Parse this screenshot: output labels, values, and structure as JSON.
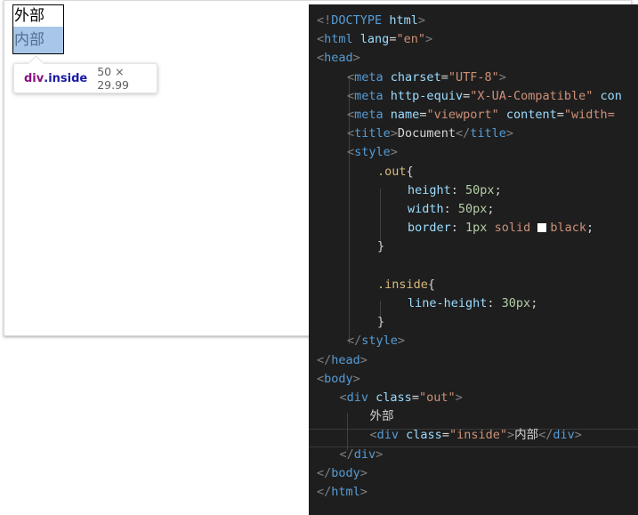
{
  "preview": {
    "out_text": "外部",
    "inside_text": "内部",
    "tooltip": {
      "tag": "div",
      "selector": ".inside",
      "dimensions": "50 × 29.99"
    }
  },
  "editor": {
    "lines": [
      {
        "indent": 0,
        "tokens": [
          {
            "c": "punct",
            "t": "<!"
          },
          {
            "c": "tag",
            "t": "DOCTYPE"
          },
          {
            "c": "text",
            "t": " "
          },
          {
            "c": "attr",
            "t": "html"
          },
          {
            "c": "punct",
            "t": ">"
          }
        ]
      },
      {
        "indent": 0,
        "tokens": [
          {
            "c": "punct",
            "t": "<"
          },
          {
            "c": "tag",
            "t": "html"
          },
          {
            "c": "text",
            "t": " "
          },
          {
            "c": "attr",
            "t": "lang"
          },
          {
            "c": "text",
            "t": "="
          },
          {
            "c": "str",
            "t": "\"en\""
          },
          {
            "c": "punct",
            "t": ">"
          }
        ]
      },
      {
        "indent": 0,
        "tokens": [
          {
            "c": "punct",
            "t": "<"
          },
          {
            "c": "tag",
            "t": "head"
          },
          {
            "c": "punct",
            "t": ">"
          }
        ]
      },
      {
        "indent": 1,
        "tokens": [
          {
            "c": "punct",
            "t": "<"
          },
          {
            "c": "tag",
            "t": "meta"
          },
          {
            "c": "text",
            "t": " "
          },
          {
            "c": "attr",
            "t": "charset"
          },
          {
            "c": "text",
            "t": "="
          },
          {
            "c": "str",
            "t": "\"UTF-8\""
          },
          {
            "c": "punct",
            "t": ">"
          }
        ]
      },
      {
        "indent": 1,
        "tokens": [
          {
            "c": "punct",
            "t": "<"
          },
          {
            "c": "tag",
            "t": "meta"
          },
          {
            "c": "text",
            "t": " "
          },
          {
            "c": "attr",
            "t": "http-equiv"
          },
          {
            "c": "text",
            "t": "="
          },
          {
            "c": "str",
            "t": "\"X-UA-Compatible\""
          },
          {
            "c": "text",
            "t": " "
          },
          {
            "c": "attr",
            "t": "con"
          }
        ]
      },
      {
        "indent": 1,
        "tokens": [
          {
            "c": "punct",
            "t": "<"
          },
          {
            "c": "tag",
            "t": "meta"
          },
          {
            "c": "text",
            "t": " "
          },
          {
            "c": "attr",
            "t": "name"
          },
          {
            "c": "text",
            "t": "="
          },
          {
            "c": "str",
            "t": "\"viewport\""
          },
          {
            "c": "text",
            "t": " "
          },
          {
            "c": "attr",
            "t": "content"
          },
          {
            "c": "text",
            "t": "="
          },
          {
            "c": "str",
            "t": "\"width="
          }
        ]
      },
      {
        "indent": 1,
        "tokens": [
          {
            "c": "punct",
            "t": "<"
          },
          {
            "c": "tag",
            "t": "title"
          },
          {
            "c": "punct",
            "t": ">"
          },
          {
            "c": "text",
            "t": "Document"
          },
          {
            "c": "punct",
            "t": "</"
          },
          {
            "c": "tag",
            "t": "title"
          },
          {
            "c": "punct",
            "t": ">"
          }
        ]
      },
      {
        "indent": 1,
        "tokens": [
          {
            "c": "punct",
            "t": "<"
          },
          {
            "c": "tag",
            "t": "style"
          },
          {
            "c": "punct",
            "t": ">"
          }
        ]
      },
      {
        "indent": 2,
        "tokens": [
          {
            "c": "sel",
            "t": ".out"
          },
          {
            "c": "text",
            "t": "{"
          }
        ]
      },
      {
        "indent": 3,
        "tokens": [
          {
            "c": "prop",
            "t": "height"
          },
          {
            "c": "text",
            "t": ": "
          },
          {
            "c": "num",
            "t": "50px"
          },
          {
            "c": "text",
            "t": ";"
          }
        ]
      },
      {
        "indent": 3,
        "tokens": [
          {
            "c": "prop",
            "t": "width"
          },
          {
            "c": "text",
            "t": ": "
          },
          {
            "c": "num",
            "t": "50px"
          },
          {
            "c": "text",
            "t": ";"
          }
        ]
      },
      {
        "indent": 3,
        "tokens": [
          {
            "c": "prop",
            "t": "border"
          },
          {
            "c": "text",
            "t": ": "
          },
          {
            "c": "num",
            "t": "1px"
          },
          {
            "c": "text",
            "t": " "
          },
          {
            "c": "val",
            "t": "solid"
          },
          {
            "c": "text",
            "t": " "
          },
          {
            "c": "swatch",
            "t": ""
          },
          {
            "c": "val",
            "t": "black"
          },
          {
            "c": "text",
            "t": ";"
          }
        ]
      },
      {
        "indent": 2,
        "tokens": [
          {
            "c": "text",
            "t": "}"
          }
        ]
      },
      {
        "indent": 2,
        "tokens": []
      },
      {
        "indent": 2,
        "tokens": [
          {
            "c": "sel",
            "t": ".inside"
          },
          {
            "c": "text",
            "t": "{"
          }
        ]
      },
      {
        "indent": 3,
        "tokens": [
          {
            "c": "prop",
            "t": "line-height"
          },
          {
            "c": "text",
            "t": ": "
          },
          {
            "c": "num",
            "t": "30px"
          },
          {
            "c": "text",
            "t": ";"
          }
        ]
      },
      {
        "indent": 2,
        "tokens": [
          {
            "c": "text",
            "t": "}"
          }
        ]
      },
      {
        "indent": 1,
        "tokens": [
          {
            "c": "punct",
            "t": "</"
          },
          {
            "c": "tag",
            "t": "style"
          },
          {
            "c": "punct",
            "t": ">"
          }
        ]
      },
      {
        "indent": 0,
        "tokens": [
          {
            "c": "punct",
            "t": "</"
          },
          {
            "c": "tag",
            "t": "head"
          },
          {
            "c": "punct",
            "t": ">"
          }
        ]
      },
      {
        "indent": 0,
        "tokens": [
          {
            "c": "punct",
            "t": "<"
          },
          {
            "c": "tag",
            "t": "body"
          },
          {
            "c": "punct",
            "t": ">"
          }
        ]
      },
      {
        "indent": 0.75,
        "tokens": [
          {
            "c": "punct",
            "t": "<"
          },
          {
            "c": "tag",
            "t": "div"
          },
          {
            "c": "text",
            "t": " "
          },
          {
            "c": "attr",
            "t": "class"
          },
          {
            "c": "text",
            "t": "="
          },
          {
            "c": "str",
            "t": "\"out\""
          },
          {
            "c": "punct",
            "t": ">"
          }
        ]
      },
      {
        "indent": 1.75,
        "tokens": [
          {
            "c": "text",
            "t": "外部"
          }
        ]
      },
      {
        "indent": 1.75,
        "tokens": [
          {
            "c": "punct",
            "t": "<"
          },
          {
            "c": "tag",
            "t": "div"
          },
          {
            "c": "text",
            "t": " "
          },
          {
            "c": "attr",
            "t": "class"
          },
          {
            "c": "text",
            "t": "="
          },
          {
            "c": "str",
            "t": "\"inside\""
          },
          {
            "c": "punct",
            "t": ">"
          },
          {
            "c": "text",
            "t": "内部"
          },
          {
            "c": "punct",
            "t": "</"
          },
          {
            "c": "tag",
            "t": "div"
          },
          {
            "c": "punct",
            "t": ">"
          }
        ]
      },
      {
        "indent": 0.75,
        "tokens": [
          {
            "c": "punct",
            "t": "</"
          },
          {
            "c": "tag",
            "t": "div"
          },
          {
            "c": "punct",
            "t": ">"
          }
        ]
      },
      {
        "indent": 0,
        "tokens": [
          {
            "c": "punct",
            "t": "</"
          },
          {
            "c": "tag",
            "t": "body"
          },
          {
            "c": "punct",
            "t": ">"
          }
        ]
      },
      {
        "indent": 0,
        "tokens": [
          {
            "c": "punct",
            "t": "</"
          },
          {
            "c": "tag",
            "t": "html"
          },
          {
            "c": "punct",
            "t": ">"
          }
        ]
      }
    ]
  }
}
